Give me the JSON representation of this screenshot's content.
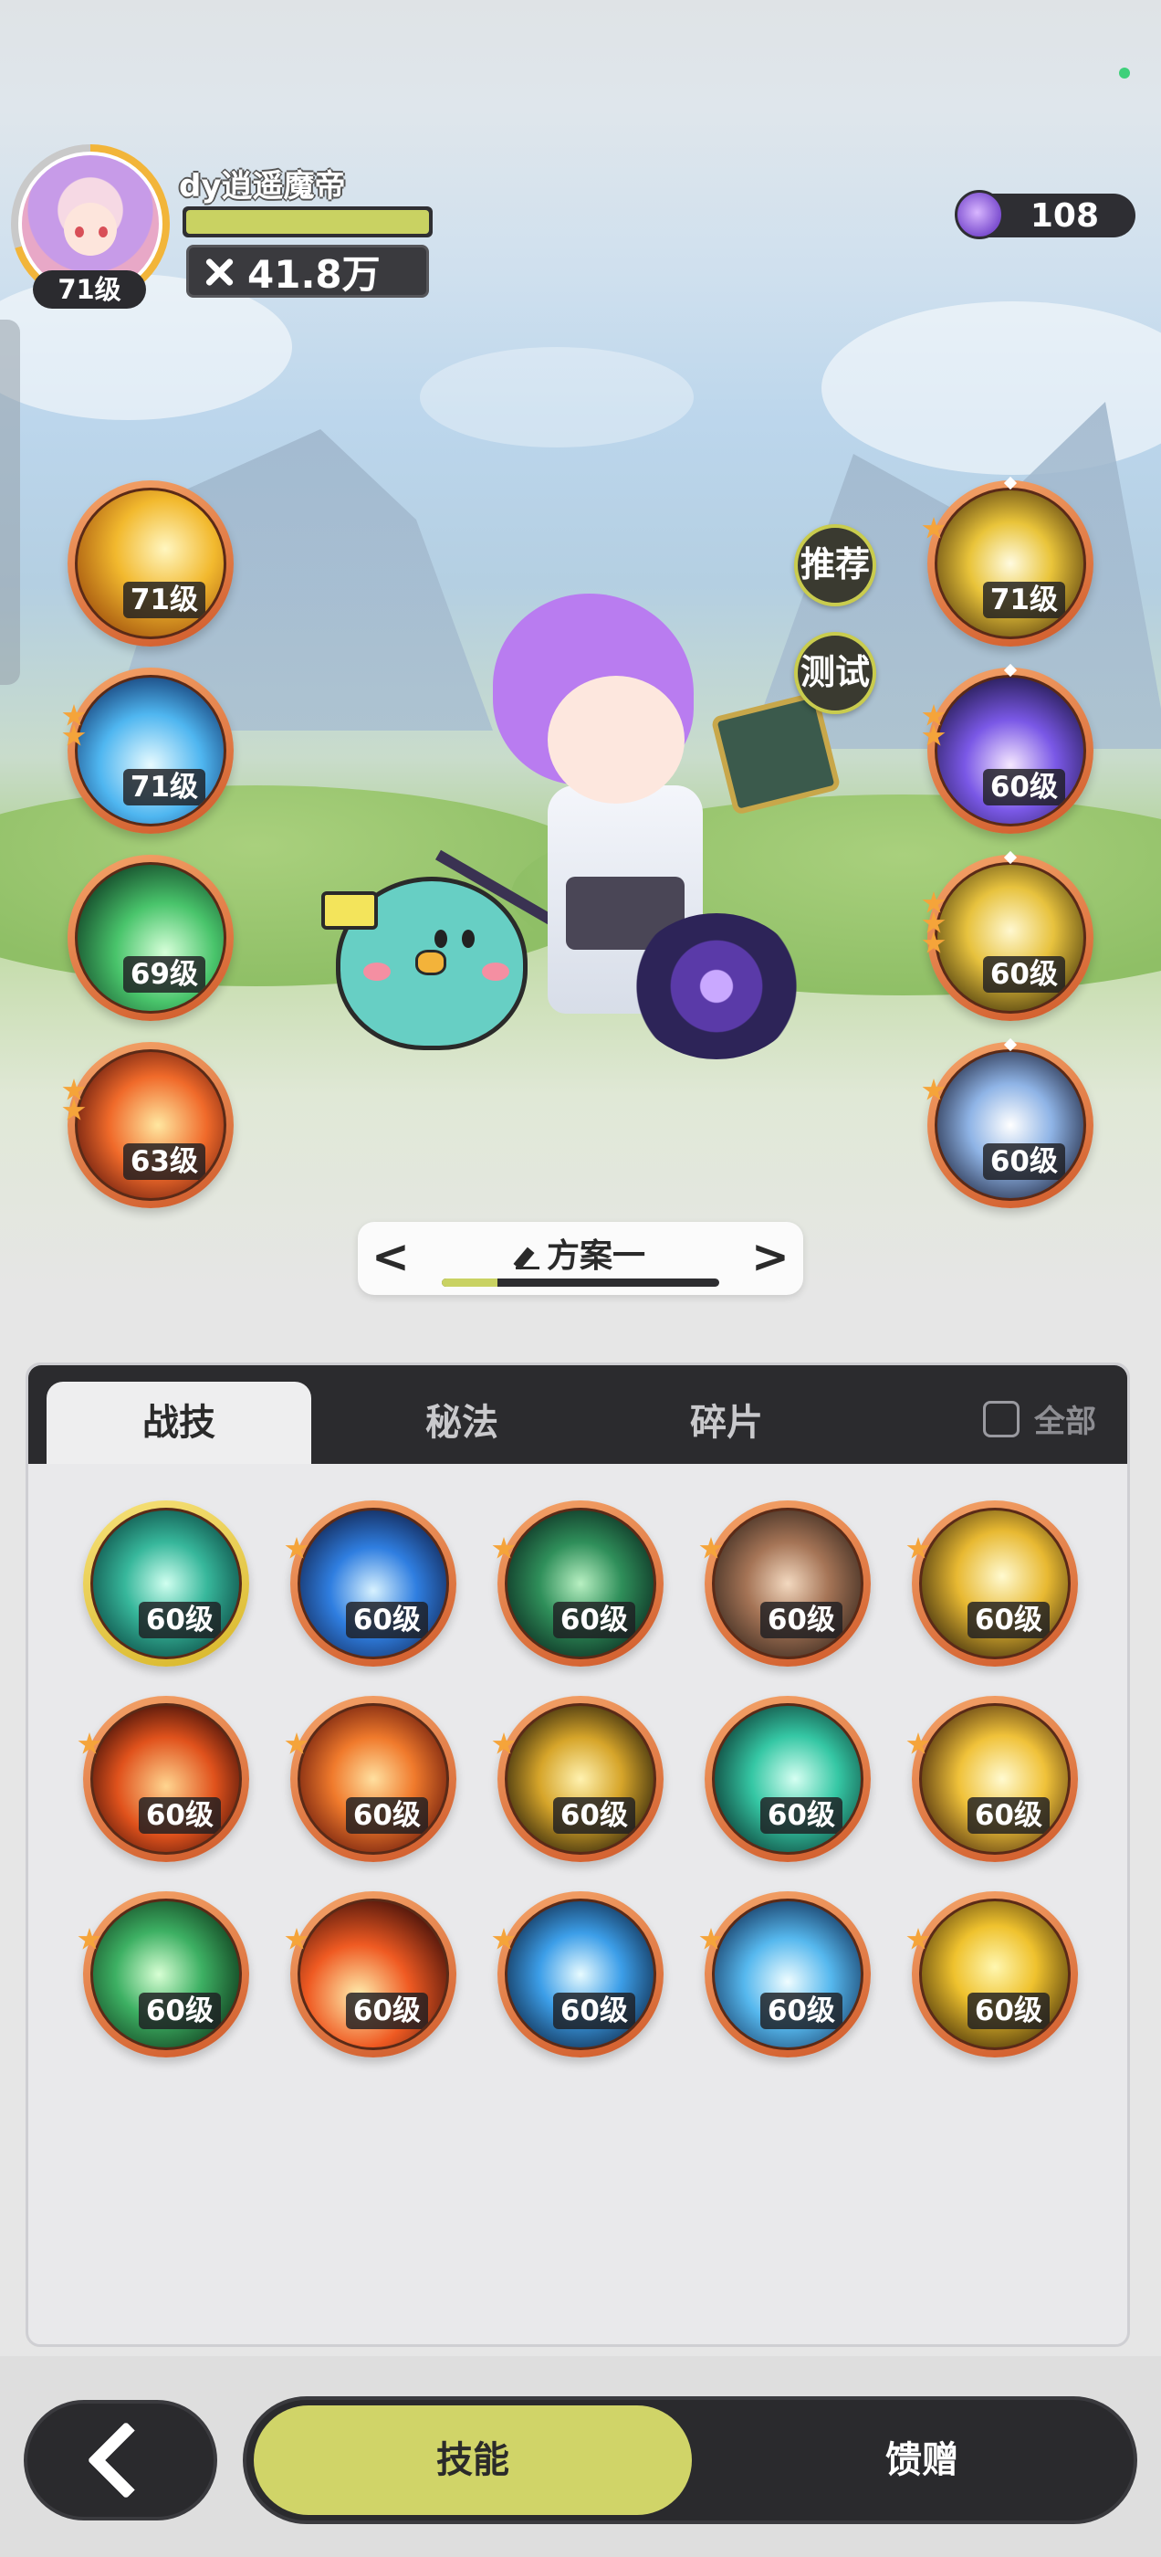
{
  "player": {
    "name": "dy逍遥魔帝",
    "level": "71级",
    "power": "41.8万",
    "exp_fraction": 1.0
  },
  "currency": {
    "amount": "108",
    "icon": "purple-gem-icon"
  },
  "side_buttons": {
    "recommend": "推荐",
    "test": "测试"
  },
  "equipped_left": [
    {
      "level": "71级",
      "icon": "golden-star-burst-icon",
      "stars": 0
    },
    {
      "level": "71级",
      "icon": "ice-shard-icon",
      "stars": 2
    },
    {
      "level": "69级",
      "icon": "green-wind-slash-icon",
      "stars": 0
    },
    {
      "level": "63级",
      "icon": "fire-swirl-icon",
      "stars": 2
    }
  ],
  "equipped_right": [
    {
      "level": "71级",
      "icon": "golden-explosion-icon",
      "stars": 1
    },
    {
      "level": "60级",
      "icon": "arcane-ring-icon",
      "stars": 2
    },
    {
      "level": "60级",
      "icon": "light-beam-icon",
      "stars": 3
    },
    {
      "level": "60级",
      "icon": "crystal-spark-icon",
      "stars": 1
    }
  ],
  "scheme": {
    "title": "方案一",
    "prev": "<",
    "next": ">",
    "progress": 0.2
  },
  "tabs": [
    {
      "label": "战技",
      "active": true
    },
    {
      "label": "秘法",
      "active": false
    },
    {
      "label": "碎片",
      "active": false
    }
  ],
  "all_toggle": {
    "label": "全部",
    "checked": false
  },
  "skill_grid": [
    {
      "level": "60级",
      "icon": "green-vortex-icon",
      "stars": 0
    },
    {
      "level": "60级",
      "icon": "blue-water-wave-icon",
      "stars": 1
    },
    {
      "level": "60级",
      "icon": "thorn-vine-icon",
      "stars": 1
    },
    {
      "level": "60级",
      "icon": "earth-rock-icon",
      "stars": 1
    },
    {
      "level": "60级",
      "icon": "golden-lightning-icon",
      "stars": 1
    },
    {
      "level": "60级",
      "icon": "fire-wave-icon",
      "stars": 1
    },
    {
      "level": "60级",
      "icon": "flame-slash-icon",
      "stars": 1
    },
    {
      "level": "60级",
      "icon": "golden-spike-icon",
      "stars": 1
    },
    {
      "level": "60级",
      "icon": "green-wind-icon",
      "stars": 0
    },
    {
      "level": "60级",
      "icon": "golden-blast-icon",
      "stars": 1
    },
    {
      "level": "60级",
      "icon": "green-heal-cross-icon",
      "stars": 1
    },
    {
      "level": "60级",
      "icon": "fire-pillar-icon",
      "stars": 1
    },
    {
      "level": "60级",
      "icon": "ice-blade-icon",
      "stars": 1
    },
    {
      "level": "60级",
      "icon": "ice-crystal-icon",
      "stars": 1
    },
    {
      "level": "60级",
      "icon": "golden-sun-icon",
      "stars": 1
    }
  ],
  "bottom_nav": {
    "back": "back-arrow-icon",
    "skills": "技能",
    "gift": "馈赠"
  },
  "colors": {
    "accent": "#d0d468",
    "dark": "#2a2a2d",
    "orb_rim": "#e07a3a",
    "star": "#f5a43a"
  }
}
